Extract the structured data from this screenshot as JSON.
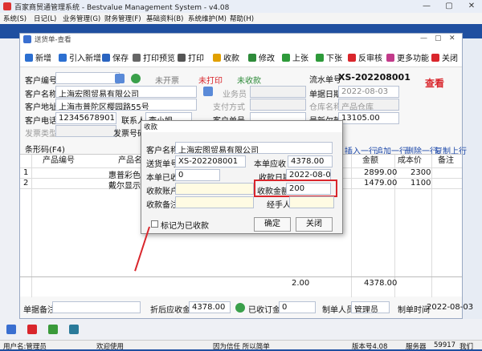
{
  "app": {
    "title": "百家商贸通管理系统 - Bestvalue Management System - v4.08",
    "controls": [
      "—",
      "▢",
      "✕"
    ]
  },
  "main_menu": [
    "系统(S)",
    "日记(L)",
    "业务管理(G)",
    "财务管理(F)",
    "基础资料(B)",
    "系统维护(M)",
    "帮助(H)"
  ],
  "child_window": {
    "title": "送货单-查看",
    "toolbar": [
      {
        "label": "新增",
        "color": "#2c6fd1"
      },
      {
        "label": "引入新增",
        "color": "#2c6fd1"
      },
      {
        "label": "保存",
        "color": "#2a64c0"
      },
      {
        "label": "打印预览",
        "color": "#666666"
      },
      {
        "label": "打印",
        "color": "#555555"
      },
      {
        "label": "收款",
        "color": "#e1a000"
      },
      {
        "label": "修改",
        "color": "#2e8b3a"
      },
      {
        "label": "上张",
        "color": "#2e9a3a"
      },
      {
        "label": "下张",
        "color": "#2e9a3a"
      },
      {
        "label": "反审核",
        "color": "#d9262c"
      },
      {
        "label": "更多功能",
        "color": "#c23a8a"
      },
      {
        "label": "关闭",
        "color": "#d9262c"
      }
    ],
    "form": {
      "customer_code_label": "客户编号",
      "customer_name_label": "客户名称",
      "customer_name": "上海宏图贸易有限公司",
      "customer_addr_label": "客户地址",
      "customer_addr": "上海市普陀区樱园路55号",
      "customer_phone_label": "客户电话",
      "customer_phone": "12345678901",
      "contact_label": "联系人",
      "contact": "李小姐",
      "invoice_type_label": "发票类型",
      "customer_invoice_label": "发票号码",
      "status_unopened": "未开票",
      "status_unprinted": "未打印",
      "status_unpaid": "未收款",
      "salesman_label": "业务员",
      "pay_method_label": "支付方式",
      "cust_order_label": "客户单号",
      "serial_label": "流水单号",
      "serial": "XS-202208001",
      "date_label": "单据日期",
      "date": "2022-08-03",
      "warehouse_label": "仓库名称",
      "warehouse": "产品仓库",
      "arrears_label": "最新欠款",
      "arrears": "13105.00",
      "view_status": "查看"
    },
    "grid": {
      "section_label": "条形码(F4)",
      "actions": [
        "插入一行",
        "追加一行",
        "删除一行",
        "复制上行"
      ],
      "columns": [
        "产品编号",
        "产品名",
        "金额",
        "成本价",
        "备注"
      ],
      "rows": [
        {
          "no": "1",
          "name": "惠普彩色激光打印",
          "amount": "2899.00",
          "cost": "2300"
        },
        {
          "no": "2",
          "name": "戴尔显示器",
          "amount": "1479.00",
          "cost": "1100"
        }
      ],
      "total_qty": "2.00",
      "total_amount": "4378.00"
    },
    "footer": {
      "remark_label": "单据备注",
      "discount_label": "折后应收金额",
      "discount_amount": "4378.00",
      "deposit_label": "已收订金",
      "deposit_value": "0",
      "creator_label": "制单人员",
      "creator": "管理员",
      "create_time_label": "制单时间",
      "create_time": "2022-08-03"
    }
  },
  "dialog": {
    "title": "收款",
    "customer_name_label": "客户名称",
    "customer_name": "上海宏图贸易有限公司",
    "doc_no_label": "送货单号",
    "doc_no": "XS-202208001",
    "due_label": "本单应收",
    "due": "4378.00",
    "received_label": "本单已收",
    "received": "0",
    "pay_date_label": "收款日期",
    "pay_date": "2022-08-09",
    "account_label": "收款账户",
    "amount_label": "收款金额",
    "amount": "200",
    "note_label": "收款备注",
    "handler_label": "经手人",
    "mark_paid_label": "标记为已收款",
    "ok": "确定",
    "close": "关闭",
    "highlight_color": "#d9262c"
  },
  "statusbar": {
    "user": "用户名:管理员",
    "welcome": "欢迎使用",
    "slogan": "因为信任 所以简单",
    "version": "版本号4.08",
    "service": "服务器",
    "port": "59917",
    "tag": "我们"
  }
}
